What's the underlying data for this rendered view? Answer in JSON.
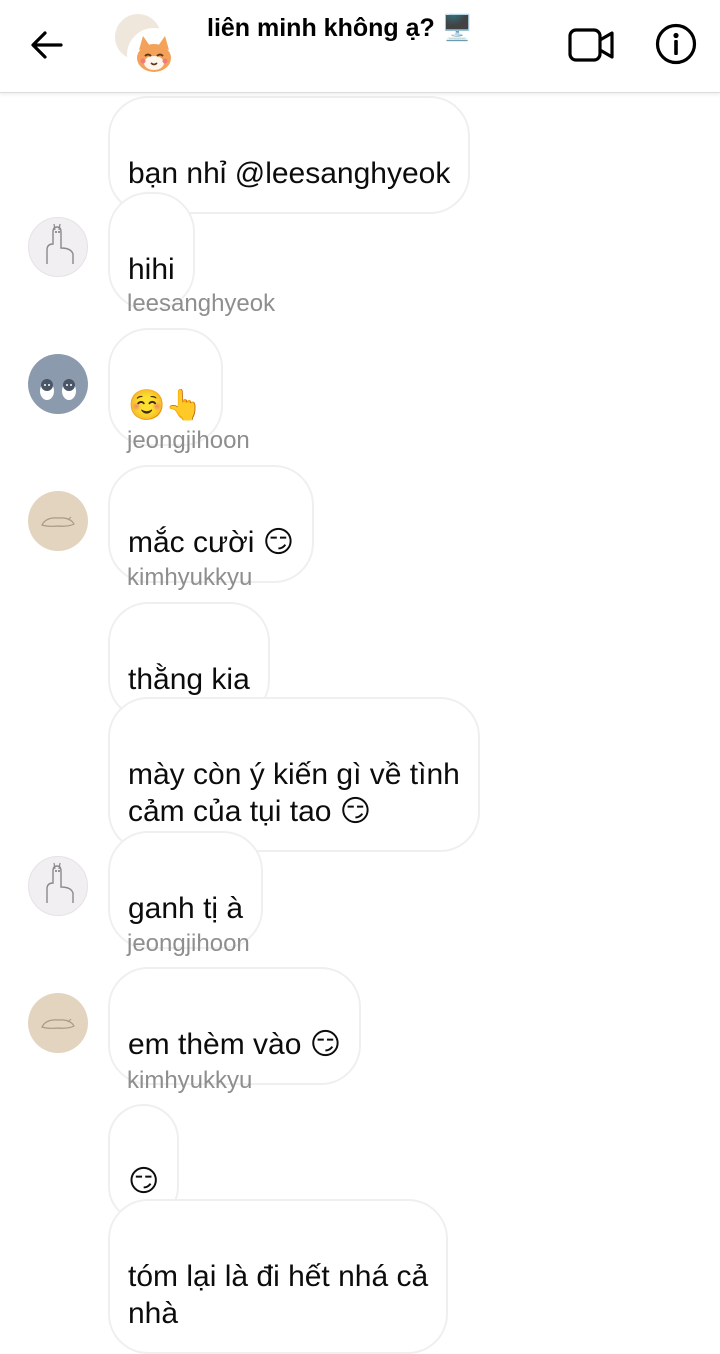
{
  "header": {
    "title": "liên minh không ạ? 🖥️",
    "back_icon": "arrow-left-icon",
    "video_icon": "video-call-icon",
    "info_icon": "info-icon"
  },
  "messages": [
    {
      "text": "bạn nhỉ @leesanghyeok"
    },
    {
      "text": "hihi",
      "avatar": "alpaca"
    },
    {
      "username": "leesanghyeok"
    },
    {
      "text": "☺️👆",
      "avatar": "penguin"
    },
    {
      "username": "jeongjihoon"
    },
    {
      "text": "mắc cười 😏",
      "avatar": "beige"
    },
    {
      "username": "kimhyukkyu"
    },
    {
      "text": "thằng kia"
    },
    {
      "text": "mày còn ý kiến gì về tình\ncảm của tụi tao 😏"
    },
    {
      "text": "ganh tị à",
      "avatar": "alpaca"
    },
    {
      "username": "jeongjihoon"
    },
    {
      "text": "em thèm vào 😏",
      "avatar": "beige"
    },
    {
      "username": "kimhyukkyu"
    },
    {
      "text": "😏"
    },
    {
      "text": "tóm lại là đi hết nhá cả\nnhà"
    }
  ],
  "colors": {
    "bubble_border": "#efefef",
    "username": "#8e8e8e",
    "header_border": "#dbdbdb"
  }
}
